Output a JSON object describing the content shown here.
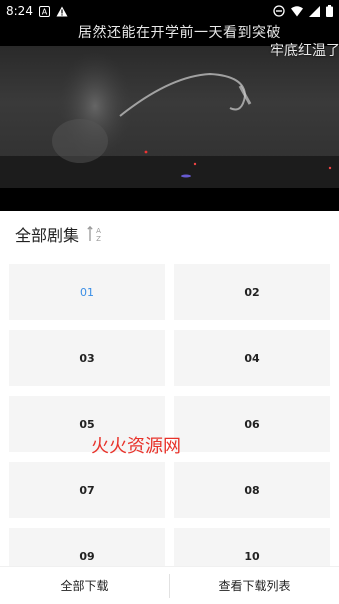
{
  "status_bar": {
    "time": "8:24",
    "icons": [
      "a-notification-icon",
      "warning-icon",
      "dnd-icon",
      "wifi-icon",
      "signal-icon",
      "battery-icon"
    ]
  },
  "video": {
    "danmaku": [
      "居然还能在开学前一天看到突破",
      "牢底红温了"
    ]
  },
  "panel": {
    "title": "全部剧集",
    "sort_icon": "sort-az-icon",
    "episodes": [
      {
        "label": "01",
        "active": true
      },
      {
        "label": "02",
        "active": false
      },
      {
        "label": "03",
        "active": false
      },
      {
        "label": "04",
        "active": false
      },
      {
        "label": "05",
        "active": false
      },
      {
        "label": "06",
        "active": false
      },
      {
        "label": "07",
        "active": false
      },
      {
        "label": "08",
        "active": false
      },
      {
        "label": "09",
        "active": false
      },
      {
        "label": "10",
        "active": false
      }
    ],
    "watermark": "火火资源网"
  },
  "bottom_bar": {
    "download_all": "全部下载",
    "view_downloads": "查看下载列表"
  },
  "colors": {
    "active": "#3a8ee6",
    "watermark": "#e8322a",
    "tile_bg": "#f5f5f5"
  }
}
